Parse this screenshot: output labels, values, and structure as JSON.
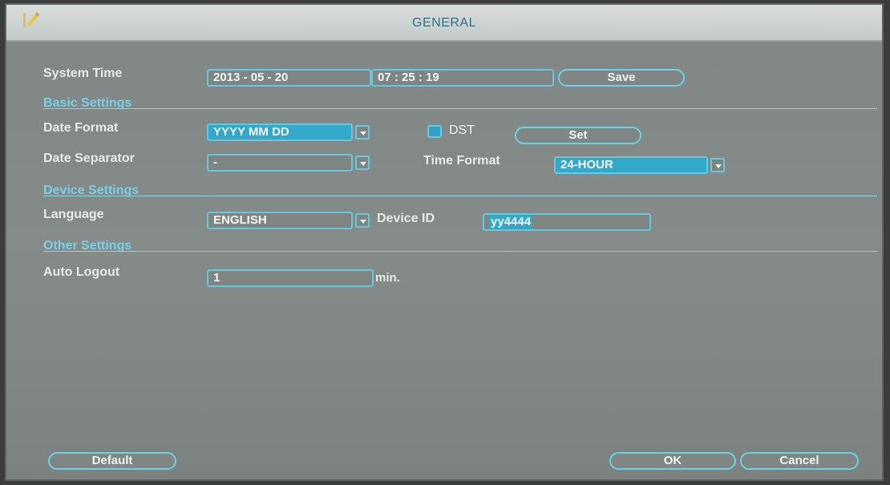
{
  "window": {
    "title": "GENERAL"
  },
  "system_time": {
    "label": "System Time",
    "date": "2013  - 05 - 20",
    "time": "07 : 25 : 19",
    "save_label": "Save"
  },
  "basic_settings": {
    "heading": "Basic Settings",
    "date_format_label": "Date Format",
    "date_format_value": "YYYY MM DD",
    "dst_label": "DST",
    "dst_checked": true,
    "set_label": "Set",
    "date_separator_label": "Date Separator",
    "date_separator_value": "-",
    "time_format_label": "Time Format",
    "time_format_value": "24-HOUR"
  },
  "device_settings": {
    "heading": "Device Settings",
    "language_label": "Language",
    "language_value": "ENGLISH",
    "device_id_label": "Device ID",
    "device_id_value": "yy4444"
  },
  "other_settings": {
    "heading": "Other Settings",
    "auto_logout_label": "Auto Logout",
    "auto_logout_value": "1",
    "auto_logout_unit": "min."
  },
  "footer": {
    "default_label": "Default",
    "ok_label": "OK",
    "cancel_label": "Cancel"
  },
  "colors": {
    "accent": "#68c6dd",
    "section_text": "#79d0e6",
    "panel": "#858b89",
    "titlebar": "#d9dedc"
  },
  "icons": {
    "app": "pencil-icon",
    "dropdown": "chevron-down-icon"
  }
}
